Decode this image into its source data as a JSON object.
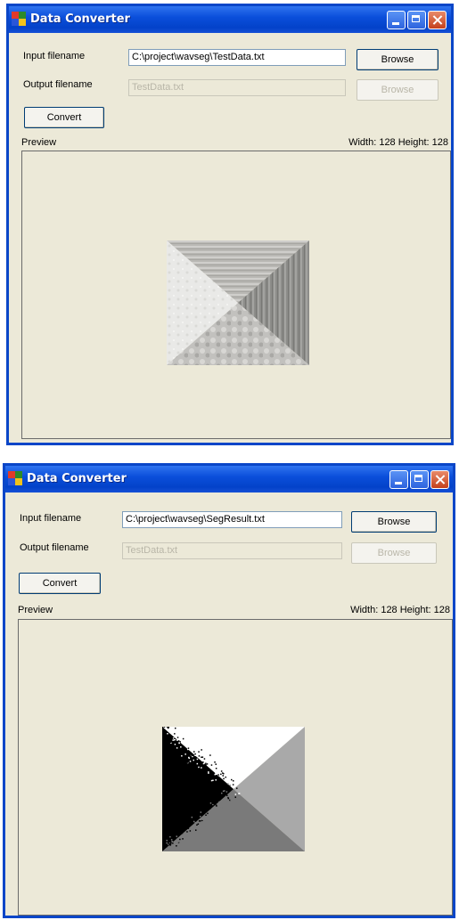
{
  "windows": [
    {
      "title": "Data Converter",
      "input_label": "Input filename",
      "input_value": "C:\\project\\wavseg\\TestData.txt",
      "browse_label": "Browse",
      "output_label": "Output filename",
      "output_value": "TestData.txt",
      "browse2_label": "Browse",
      "convert_label": "Convert",
      "preview_label": "Preview",
      "dims": "Width: 128  Height: 128",
      "image_kind": "grayscale-textured-triangles"
    },
    {
      "title": "Data Converter",
      "input_label": "Input filename",
      "input_value": "C:\\project\\wavseg\\SegResult.txt",
      "browse_label": "Browse",
      "output_label": "Output filename",
      "output_value": "TestData.txt",
      "browse2_label": "Browse",
      "convert_label": "Convert",
      "preview_label": "Preview",
      "dims": "Width: 128  Height: 128",
      "image_kind": "segmented-four-region-triangles"
    }
  ],
  "colors": {
    "titlebar": "#0b4fdb",
    "window_bg": "#ece9d8",
    "close_button": "#c4401c"
  }
}
